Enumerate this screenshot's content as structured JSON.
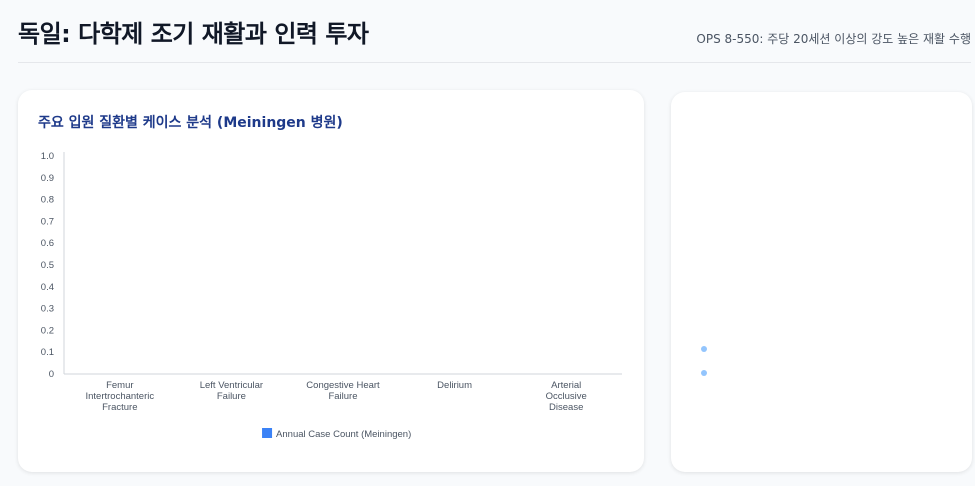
{
  "header": {
    "title": "독일: 다학제 조기 재활과 인력 투자",
    "subtitle": "OPS 8-550: 주당 20세션 이상의 강도 높은 재활 수행"
  },
  "chart_card": {
    "title": "주요 입원 질환별 케이스 분석 (Meiningen 병원)"
  },
  "chart_data": {
    "type": "bar",
    "title": "주요 입원 질환별 케이스 분석 (Meiningen 병원)",
    "categories": [
      [
        "Femur",
        "Intertrochanteric",
        "Fracture"
      ],
      [
        "Left Ventricular",
        "Failure"
      ],
      [
        "Congestive Heart",
        "Failure"
      ],
      [
        "Delirium"
      ],
      [
        "Arterial",
        "Occlusive",
        "Disease"
      ]
    ],
    "series": [
      {
        "name": "Annual Case Count (Meiningen)",
        "values": [
          null,
          null,
          null,
          null,
          null
        ],
        "color": "#3b82f6"
      }
    ],
    "ylim": [
      0,
      1.0
    ],
    "yticks": [
      "0",
      "0.1",
      "0.2",
      "0.3",
      "0.4",
      "0.5",
      "0.6",
      "0.7",
      "0.8",
      "0.9",
      "1.0"
    ],
    "xlabel": "",
    "ylabel": "",
    "legend_position": "bottom",
    "grid": false
  },
  "side_card": {
    "dot_color": "#93c5fd"
  }
}
